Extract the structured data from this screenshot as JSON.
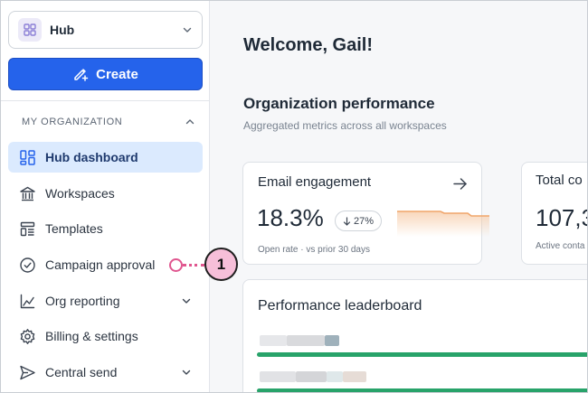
{
  "sidebar": {
    "hub_label": "Hub",
    "create_label": "Create",
    "section_title": "MY ORGANIZATION",
    "items": [
      {
        "label": "Hub dashboard"
      },
      {
        "label": "Workspaces"
      },
      {
        "label": "Templates"
      },
      {
        "label": "Campaign approval"
      },
      {
        "label": "Org reporting"
      },
      {
        "label": "Billing & settings"
      },
      {
        "label": "Central send"
      }
    ]
  },
  "callout": {
    "number": "1"
  },
  "main": {
    "welcome": "Welcome, Gail!",
    "org_title": "Organization performance",
    "org_subtitle": "Aggregated metrics across all workspaces",
    "email_card": {
      "title": "Email engagement",
      "value": "18.3%",
      "trend": "27%",
      "footnote": "Open rate · vs prior 30 days"
    },
    "total_card": {
      "title": "Total co",
      "value": "107,3",
      "footnote": "Active conta"
    },
    "leaderboard": {
      "title": "Performance leaderboard"
    }
  },
  "colors": {
    "accent": "#2563eb",
    "active_bg": "#dbeafe",
    "callout": "#e0568f",
    "bar": "#28a36a",
    "sparkline": "#f0a56a"
  }
}
